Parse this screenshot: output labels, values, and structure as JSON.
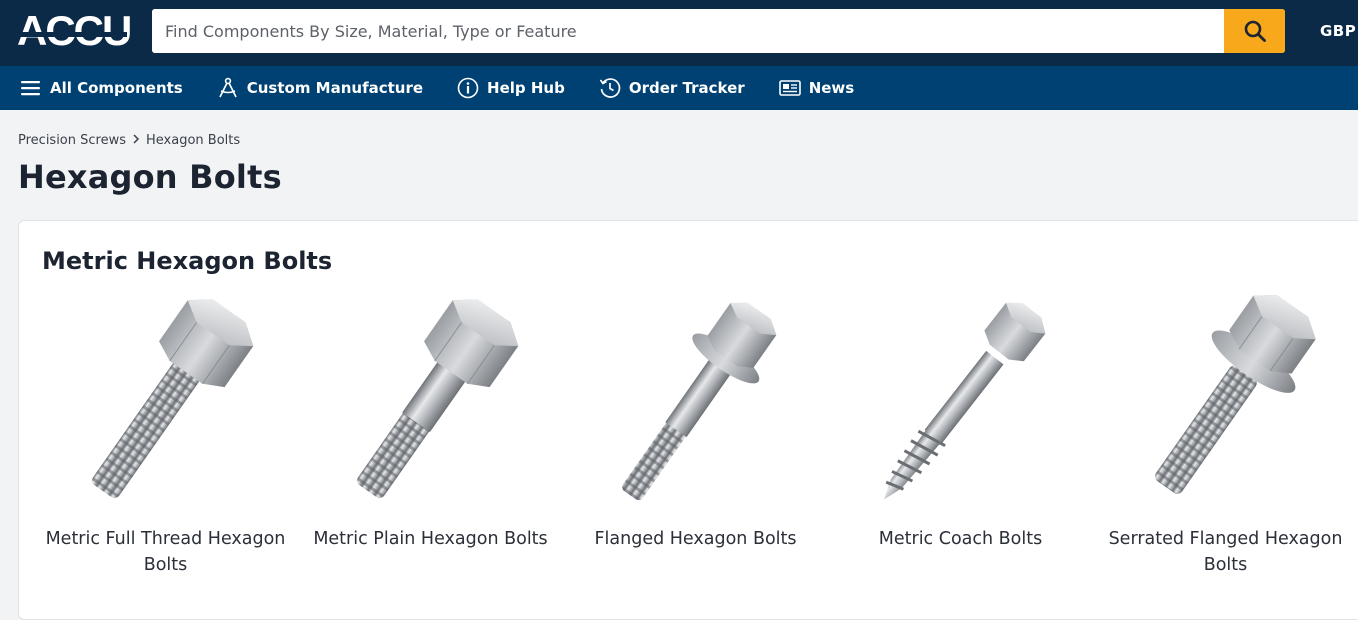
{
  "header": {
    "logo_text": "ACCU",
    "search_placeholder": "Find Components By Size, Material, Type or Feature",
    "search_icon": "search-icon",
    "currency": "GBP",
    "accent_color": "#f7a81b",
    "bg_color": "#0b2a47"
  },
  "nav": {
    "bg_color": "#004174",
    "items": [
      {
        "label": "All Components",
        "icon": "menu-icon"
      },
      {
        "label": "Custom Manufacture",
        "icon": "compass-icon"
      },
      {
        "label": "Help Hub",
        "icon": "info-icon"
      },
      {
        "label": "Order Tracker",
        "icon": "history-icon"
      },
      {
        "label": "News",
        "icon": "newspaper-icon"
      }
    ]
  },
  "breadcrumb": {
    "items": [
      "Precision Screws",
      "Hexagon Bolts"
    ],
    "separator_icon": "chevron-right-icon"
  },
  "page_title": "Hexagon Bolts",
  "section": {
    "title": "Metric Hexagon Bolts",
    "products": [
      {
        "name": "Metric Full Thread Hexagon Bolts",
        "image": "full-thread-hex-bolt-image"
      },
      {
        "name": "Metric Plain Hexagon Bolts",
        "image": "plain-hex-bolt-image"
      },
      {
        "name": "Flanged Hexagon Bolts",
        "image": "flanged-hex-bolt-image"
      },
      {
        "name": "Metric Coach Bolts",
        "image": "coach-bolt-image"
      },
      {
        "name": "Serrated Flanged Hexagon Bolts",
        "image": "serrated-flanged-hex-bolt-image"
      }
    ]
  }
}
